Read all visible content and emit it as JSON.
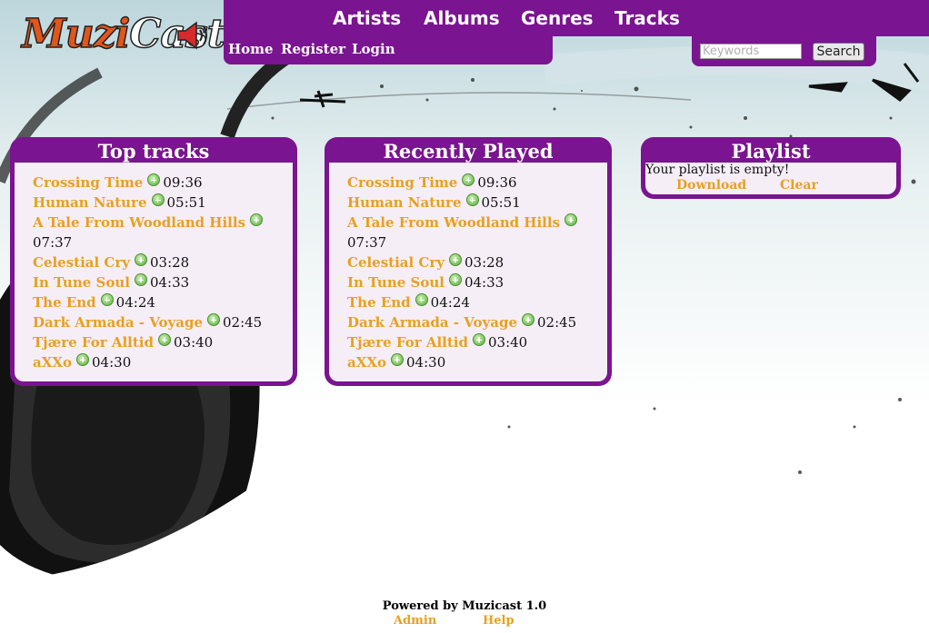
{
  "logo": {
    "part1": "Muzi",
    "part2": "Cast"
  },
  "nav": {
    "main": [
      {
        "label": "Artists"
      },
      {
        "label": "Albums"
      },
      {
        "label": "Genres"
      },
      {
        "label": "Tracks"
      }
    ],
    "sub": [
      {
        "label": "Home"
      },
      {
        "label": "Register"
      },
      {
        "label": "Login"
      }
    ]
  },
  "search": {
    "placeholder": "Keywords",
    "button_label": "Search"
  },
  "top_tracks": {
    "title": "Top tracks",
    "items": [
      {
        "name": "Crossing Time",
        "duration": "09:36"
      },
      {
        "name": "Human Nature",
        "duration": "05:51"
      },
      {
        "name": "A Tale From Woodland Hills",
        "duration": "07:37"
      },
      {
        "name": "Celestial Cry",
        "duration": "03:28"
      },
      {
        "name": "In Tune Soul",
        "duration": "04:33"
      },
      {
        "name": "The End",
        "duration": "04:24"
      },
      {
        "name": "Dark Armada - Voyage",
        "duration": "02:45"
      },
      {
        "name": "Tjære For Alltid",
        "duration": "03:40"
      },
      {
        "name": "aXXo",
        "duration": "04:30"
      }
    ]
  },
  "recently_played": {
    "title": "Recently Played",
    "items": [
      {
        "name": "Crossing Time",
        "duration": "09:36"
      },
      {
        "name": "Human Nature",
        "duration": "05:51"
      },
      {
        "name": "A Tale From Woodland Hills",
        "duration": "07:37"
      },
      {
        "name": "Celestial Cry",
        "duration": "03:28"
      },
      {
        "name": "In Tune Soul",
        "duration": "04:33"
      },
      {
        "name": "The End",
        "duration": "04:24"
      },
      {
        "name": "Dark Armada - Voyage",
        "duration": "02:45"
      },
      {
        "name": "Tjære For Alltid",
        "duration": "03:40"
      },
      {
        "name": "aXXo",
        "duration": "04:30"
      }
    ]
  },
  "playlist": {
    "title": "Playlist",
    "empty_text": "Your playlist is empty!",
    "download_label": "Download",
    "clear_label": "Clear"
  },
  "footer": {
    "powered_by": "Powered by Muzicast 1.0",
    "admin_label": "Admin",
    "help_label": "Help"
  },
  "colors": {
    "brand_purple": "#7a1490",
    "link_orange": "#e8a020",
    "add_green": "#5aae3c"
  },
  "icons": [
    "add-to-playlist-icon",
    "speaker-icon",
    "headphones-art"
  ]
}
